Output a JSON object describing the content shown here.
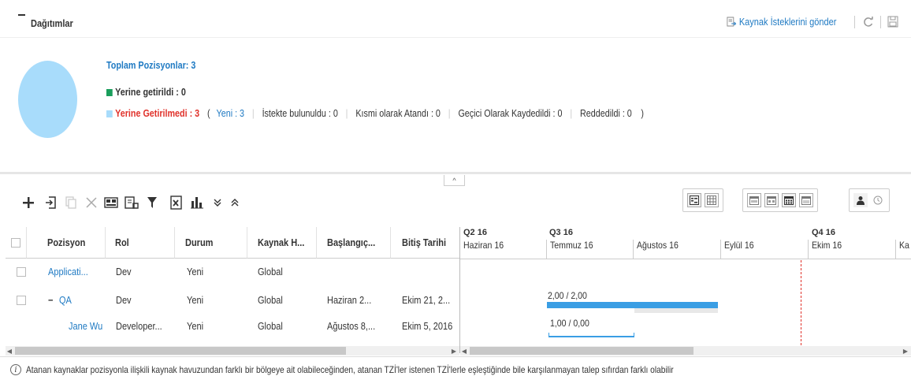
{
  "header": {
    "title": "Dağıtımlar",
    "send_requests_label": "Kaynak İsteklerini gönder"
  },
  "summary": {
    "total_positions": "Toplam Pozisyonlar: 3",
    "fulfilled": "Yerine getirildi : 0",
    "unfulfilled": "Yerine Getirilmedi : 3",
    "open_paren": "(",
    "new": "Yeni : 3",
    "requested": "İstekte bulunuldu : 0",
    "partially_assigned": "Kısmi olarak Atandı : 0",
    "temp_saved": "Geçici Olarak Kaydedildi : 0",
    "rejected": "Reddedildi : 0",
    "close_paren": ")",
    "colors": {
      "fulfilled": "#1a9e5c",
      "unfulfilled_square": "#a8dcfb",
      "unfulfilled_text": "#e0322b",
      "link": "#1f7ac3"
    }
  },
  "toolbar": {
    "icons": [
      "add-icon",
      "import-icon",
      "copy-icon",
      "delete-icon",
      "assign-resource-icon",
      "request-icon",
      "filter-icon",
      "export-excel-icon",
      "chart-icon",
      "expand-all-icon",
      "collapse-all-icon"
    ],
    "view_icons": [
      "grid-gantt-view-icon",
      "table-view-icon",
      "year-view-icon",
      "quarter-view-icon",
      "month-view-icon",
      "week-view-icon",
      "resource-icon",
      "clock-icon"
    ]
  },
  "grid": {
    "columns": [
      "Pozisyon",
      "Rol",
      "Durum",
      "Kaynak H...",
      "Başlangıç...",
      "Bitiş Tarihi"
    ],
    "rows": [
      {
        "position": "Applicati...",
        "role": "Dev",
        "status": "Yeni",
        "pool": "Global",
        "start": "",
        "end": ""
      },
      {
        "expander": "−",
        "position": "QA",
        "role": "Dev",
        "status": "Yeni",
        "pool": "Global",
        "start": "Haziran 2...",
        "end": "Ekim 21, 2..."
      },
      {
        "position": "Jane Wu",
        "role": "Developer...",
        "status": "Yeni",
        "pool": "Global",
        "start": "Ağustos 8,...",
        "end": "Ekim 5, 2016"
      }
    ]
  },
  "gantt": {
    "quarters": [
      "Q2 16",
      "Q3 16",
      "Q4 16"
    ],
    "months": [
      "Haziran 16",
      "Temmuz 16",
      "Ağustos 16",
      "Eylül 16",
      "Ekim 16",
      "Ka"
    ],
    "bars": [
      {
        "label": "2,00 / 2,00"
      },
      {
        "label": "1,00 / 0,00"
      }
    ],
    "bar_color": "#3a9ee4",
    "today_line_color": "#e0322b"
  },
  "footer": {
    "info_symbol": "i",
    "note": "Atanan kaynaklar pozisyonla ilişkili kaynak havuzundan farklı bir bölgeye ait olabileceğinden, atanan TZİ'ler istenen TZİ'lerle eşleştiğinde bile karşılanmayan talep sıfırdan farklı olabilir"
  }
}
